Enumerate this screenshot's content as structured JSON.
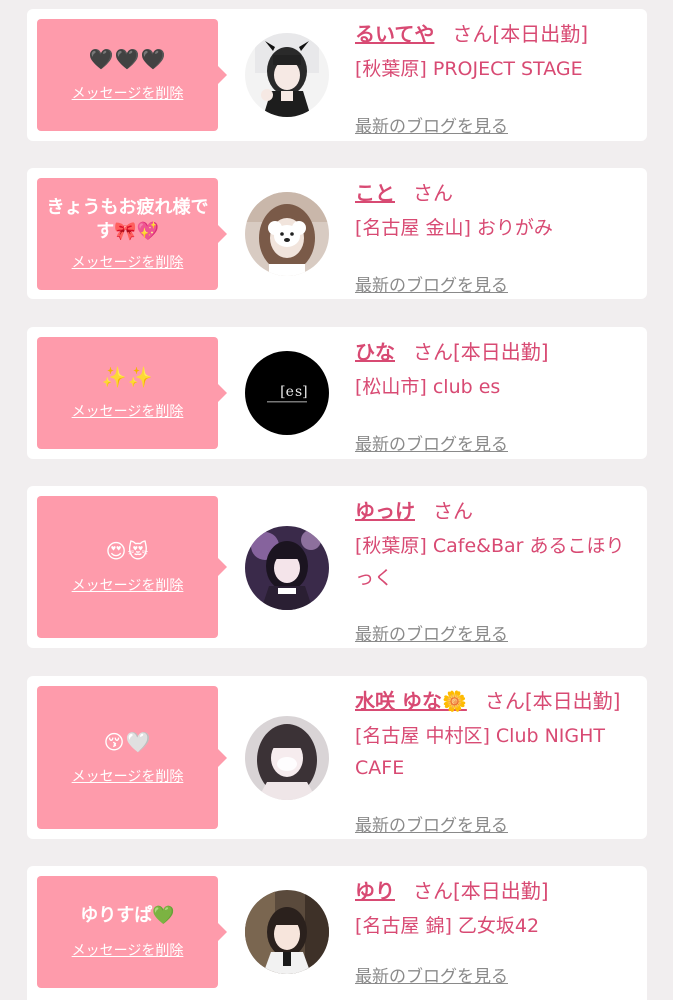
{
  "colors": {
    "accent_pink": "#fe9bab",
    "name_pink": "#d84a73",
    "link_gray": "#8a8a8a",
    "background": "#f1eeef"
  },
  "entries": [
    {
      "message": "🖤🖤🖤",
      "delete_label": "メッセージを削除",
      "avatar_icon": "girl-photo-monochrome",
      "name": "るいてや",
      "honorific": "さん",
      "status": "[本日出勤]",
      "shop": "[秋葉原] PROJECT STAGE",
      "blog_link": "最新のブログを見る"
    },
    {
      "message": "きょうもお疲れ様です🎀💖",
      "delete_label": "メッセージを削除",
      "avatar_icon": "girl-photo-dog-sticker",
      "name": "こと",
      "honorific": "さん",
      "status": "",
      "shop": "[名古屋 金山] おりがみ",
      "blog_link": "最新のブログを見る"
    },
    {
      "message": "✨✨",
      "delete_label": "メッセージを削除",
      "avatar_icon": "club-es-logo",
      "name": "ひな",
      "honorific": "さん",
      "status": "[本日出勤]",
      "shop": "[松山市] club es",
      "blog_link": "最新のブログを見る"
    },
    {
      "message": "😍😻",
      "delete_label": "メッセージを削除",
      "avatar_icon": "girl-photo-purple",
      "name": "ゆっけ",
      "honorific": "さん",
      "status": "",
      "shop": "[秋葉原] Cafe&Bar あるこほりっく",
      "blog_link": "最新のブログを見る"
    },
    {
      "message": "😚🤍",
      "delete_label": "メッセージを削除",
      "avatar_icon": "girl-photo-blurred",
      "name": "水咲 ゆな🌼",
      "honorific": "さん",
      "status": "[本日出勤]",
      "shop": "[名古屋 中村区] Club NIGHT CAFE",
      "blog_link": "最新のブログを見る"
    },
    {
      "message": "ゆりすぱ💚",
      "delete_label": "メッセージを削除",
      "avatar_icon": "girl-photo-selfie",
      "name": "ゆり",
      "honorific": "さん",
      "status": "[本日出勤]",
      "shop": "[名古屋 錦] 乙女坂42",
      "blog_link": "最新のブログを見る"
    }
  ]
}
